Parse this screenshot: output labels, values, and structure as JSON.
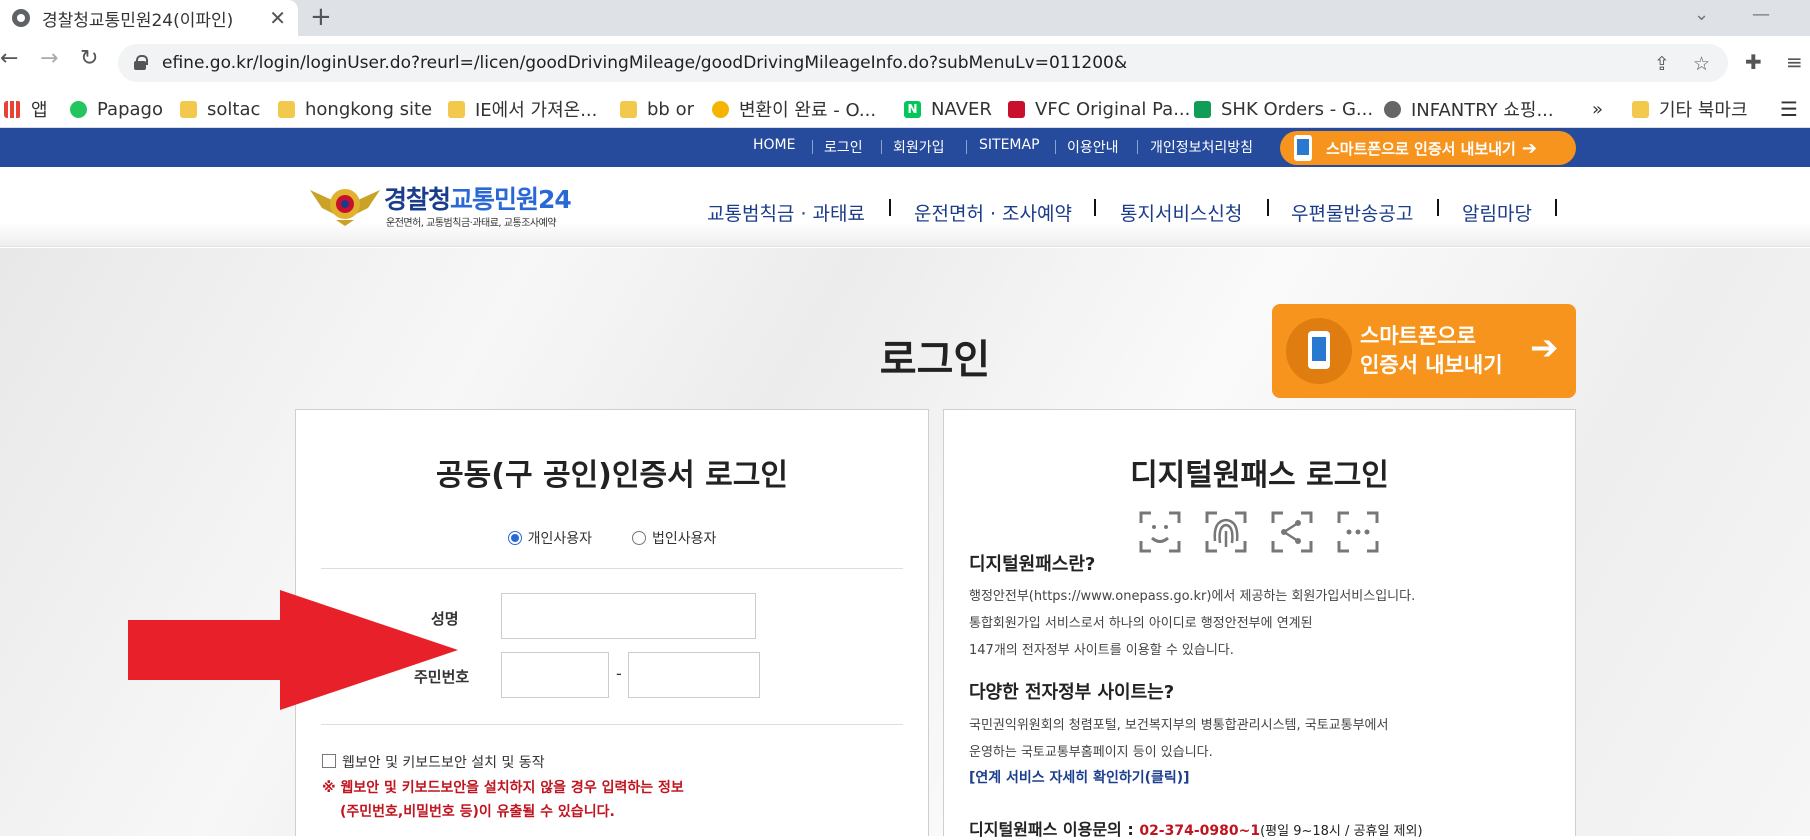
{
  "browser": {
    "tab_title": "경찰청교통민원24(이파인)",
    "tab_close": "✕",
    "new_tab": "+",
    "url": "efine.go.kr/login/loginUser.do?reurl=/licen/goodDrivingMileage/goodDrivingMileageInfo.do?subMenuLv=011200&",
    "bookmarks": [
      {
        "label": "앱",
        "icon": "apps-icon"
      },
      {
        "label": "Papago",
        "icon": "papago-icon"
      },
      {
        "label": "soltac",
        "icon": "folder-icon"
      },
      {
        "label": "hongkong site",
        "icon": "folder-icon"
      },
      {
        "label": "IE에서 가져온...",
        "icon": "folder-icon"
      },
      {
        "label": "bb or",
        "icon": "folder-icon"
      },
      {
        "label": "변환이 완료 - O...",
        "icon": "convert-icon"
      },
      {
        "label": "NAVER",
        "icon": "naver-icon"
      },
      {
        "label": "VFC Original Pa...",
        "icon": "mle-icon"
      },
      {
        "label": "SHK Orders - G...",
        "icon": "sheets-icon"
      },
      {
        "label": "INFANTRY 쇼핑...",
        "icon": "globe-icon"
      }
    ],
    "bookmarks_more": "»",
    "other_bookmarks": "기타 북마크"
  },
  "site": {
    "top_links": [
      "HOME",
      "로그인",
      "회원가입",
      "SITEMAP",
      "이용안내",
      "개인정보처리방침"
    ],
    "smart_export_label": "스마트폰으로 인증서 내보내기",
    "logo_title_1": "경찰청",
    "logo_title_2": "교통민원24",
    "logo_subtitle": "운전면허, 교통범칙금·과태료, 교통조사예약",
    "main_menu": [
      "교통범칙금 · 과태료",
      "운전면허 · 조사예약",
      "통지서비스신청",
      "우편물반송공고",
      "알림마당"
    ]
  },
  "page": {
    "title": "로그인",
    "big_smart_line1": "스마트폰으로",
    "big_smart_line2": "인증서 내보내기",
    "big_smart_arrow": "➔"
  },
  "cert_login": {
    "title": "공동(구 공인)인증서 로그인",
    "radio_personal": "개인사용자",
    "radio_corporate": "법인사용자",
    "selected": "개인사용자",
    "name_label": "성명",
    "rrn_label": "주민번호",
    "rrn_dash": "-",
    "security_checkbox_label": "웹보안 및 키보드보안 설치 및 동작",
    "warning_line1": "※ 웹보안 및 키보드보안을 설치하지 않을 경우 입력하는 정보",
    "warning_line2": "(주민번호,비밀번호 등)이 유출될 수 있습니다."
  },
  "onepass_login": {
    "title": "디지털원패스 로그인",
    "biometric_icons": [
      "face-scan-icon",
      "fingerprint-icon",
      "pattern-icon",
      "pin-icon"
    ],
    "what_heading": "디지털원패스란?",
    "what_text": [
      "행정안전부(https://www.onepass.go.kr)에서 제공하는 회원가입서비스입니다.",
      "통합회원가입 서비스로서 하나의 아이디로 행정안전부에 연계된",
      "147개의 전자정부 사이트를 이용할 수 있습니다."
    ],
    "sites_heading": "다양한 전자정부 사이트는?",
    "sites_text": [
      "국민권익위원회의 청렴포털, 보건복지부의 병통합관리시스템, 국토교통부에서",
      "운영하는 국토교통부홈페이지 등이 있습니다."
    ],
    "sites_link": "[연계 서비스 자세히 확인하기(클릭)]",
    "inquiry_heading": "디지털원패스 이용문의 :",
    "inquiry_phone": "02-374-0980~1",
    "inquiry_hours": "(평일 9~18시 / 공휴일 제외)"
  },
  "colors": {
    "nav_blue": "#264a9c",
    "accent_orange": "#f7941d",
    "warning_red": "#c0141f",
    "annotation_arrow": "#e8202a"
  }
}
